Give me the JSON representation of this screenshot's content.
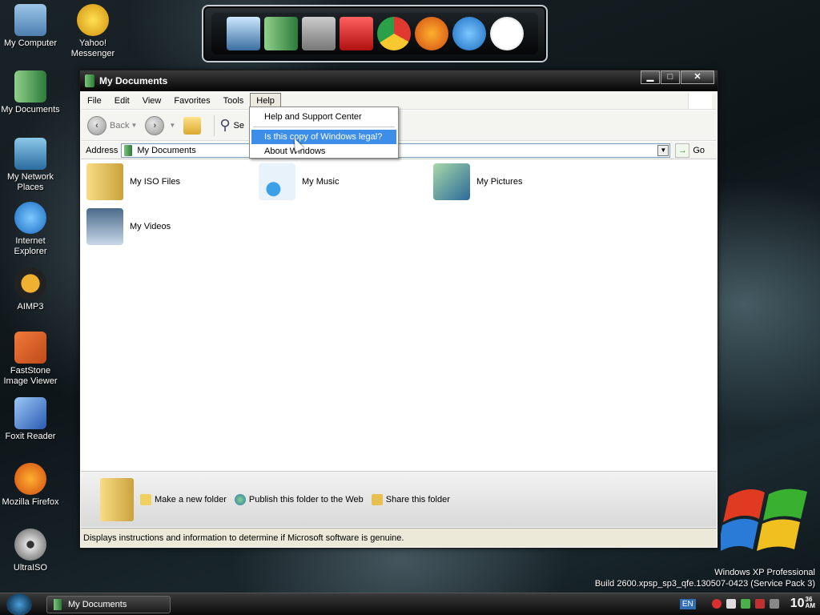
{
  "desktop": {
    "icons": [
      {
        "label": "My Computer",
        "color": "#4c7fb0"
      },
      {
        "label": "Yahoo! Messenger",
        "color": "#f0c020"
      },
      {
        "label": "My Documents",
        "color": "#5aa86a"
      },
      {
        "label": "My Network Places",
        "color": "#3c8cc0"
      },
      {
        "label": "Internet Explorer",
        "color": "#2d86d9"
      },
      {
        "label": "AIMP3",
        "color": "#e8a020"
      },
      {
        "label": "FastStone Image Viewer",
        "color": "#e06a2a"
      },
      {
        "label": "Foxit Reader",
        "color": "#3a7ad0"
      },
      {
        "label": "Mozilla Firefox",
        "color": "#e86a1a"
      },
      {
        "label": "UltraISO",
        "color": "#a0a0a0"
      }
    ]
  },
  "window": {
    "title": "My Documents",
    "buttons": {
      "minimize": "▁",
      "maximize": "□",
      "close": "✕"
    }
  },
  "menubar": {
    "items": [
      "File",
      "Edit",
      "View",
      "Favorites",
      "Tools",
      "Help"
    ]
  },
  "toolbar": {
    "back": "Back",
    "search": "Se"
  },
  "addressbar": {
    "label": "Address",
    "value": "My Documents",
    "go": "Go"
  },
  "files": [
    {
      "name": "My ISO Files",
      "icon": "folder-icon"
    },
    {
      "name": "My Music",
      "icon": "music-icon"
    },
    {
      "name": "My Pictures",
      "icon": "pictures-icon"
    },
    {
      "name": "My Videos",
      "icon": "videos-icon"
    }
  ],
  "taskpane": {
    "items": [
      "Make a new folder",
      "Publish this folder to the Web",
      "Share this folder"
    ]
  },
  "statusbar": {
    "text": "Displays instructions and information to determine if Microsoft software is genuine."
  },
  "help_menu": {
    "items": [
      "Help and Support Center",
      "Is this copy of Windows legal?",
      "About Windows"
    ]
  },
  "taskbar": {
    "task": "My Documents",
    "lang": "EN",
    "clock_hour": "10",
    "clock_min": "36",
    "clock_ampm": "AM"
  },
  "build": {
    "line1": "Windows XP Professional",
    "line2": "Build 2600.xpsp_sp3_qfe.130507-0423 (Service Pack 3)"
  },
  "colors": {
    "accent": "#3d8ee8"
  }
}
